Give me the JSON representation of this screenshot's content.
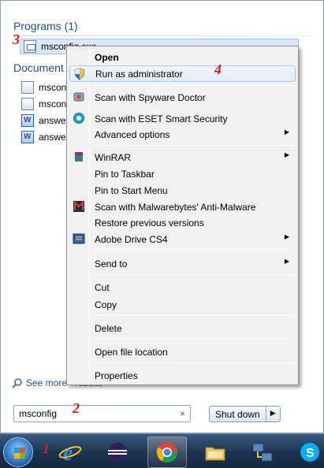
{
  "start_menu": {
    "programs_header": "Programs (1)",
    "program_result": "msconfig.exe",
    "documents_header": "Document",
    "document_results": [
      "msconfi",
      "msconfi",
      "answer",
      "answer"
    ],
    "see_more": "See more",
    "see_more_tail": "results",
    "search_value": "msconfig",
    "search_clear": "×",
    "shutdown_label": "Shut down",
    "shutdown_arrow": "▶"
  },
  "context_menu": {
    "items": [
      {
        "label": "Open",
        "bold": true,
        "icon": "none"
      },
      {
        "label": "Run as administrator",
        "icon": "uac-shield-icon",
        "highlighted": true
      },
      {
        "label": "Scan with Spyware Doctor",
        "icon": "spyware-doctor-icon"
      },
      {
        "label": "Scan with ESET Smart Security",
        "icon": "eset-icon"
      },
      {
        "label": "Advanced options",
        "icon": "none",
        "submenu": true
      },
      {
        "label": "WinRAR",
        "icon": "winrar-icon",
        "submenu": true
      },
      {
        "label": "Pin to Taskbar",
        "icon": "none"
      },
      {
        "label": "Pin to Start Menu",
        "icon": "none"
      },
      {
        "label": "Scan with Malwarebytes' Anti-Malware",
        "icon": "malwarebytes-icon"
      },
      {
        "label": "Restore previous versions",
        "icon": "none"
      },
      {
        "label": "Adobe Drive CS4",
        "icon": "adobe-drive-icon",
        "submenu": true
      },
      {
        "label": "Send to",
        "icon": "none",
        "submenu": true
      },
      {
        "label": "Cut",
        "icon": "none"
      },
      {
        "label": "Copy",
        "icon": "none"
      },
      {
        "label": "Delete",
        "icon": "none"
      },
      {
        "label": "Open file location",
        "icon": "none"
      },
      {
        "label": "Properties",
        "icon": "none"
      }
    ],
    "submenu_arrow": "▶"
  },
  "annotations": {
    "one": "1",
    "two": "2",
    "three": "3",
    "four": "4"
  },
  "taskbar": {
    "buttons": [
      "start-orb-icon",
      "internet-explorer-icon",
      "eclipse-icon",
      "chrome-icon",
      "file-explorer-icon",
      "network-icon",
      "skype-icon"
    ]
  },
  "colors": {
    "accent": "#1e4e8c",
    "annotation": "#d11e1e",
    "highlight": "#e1ebf7"
  }
}
